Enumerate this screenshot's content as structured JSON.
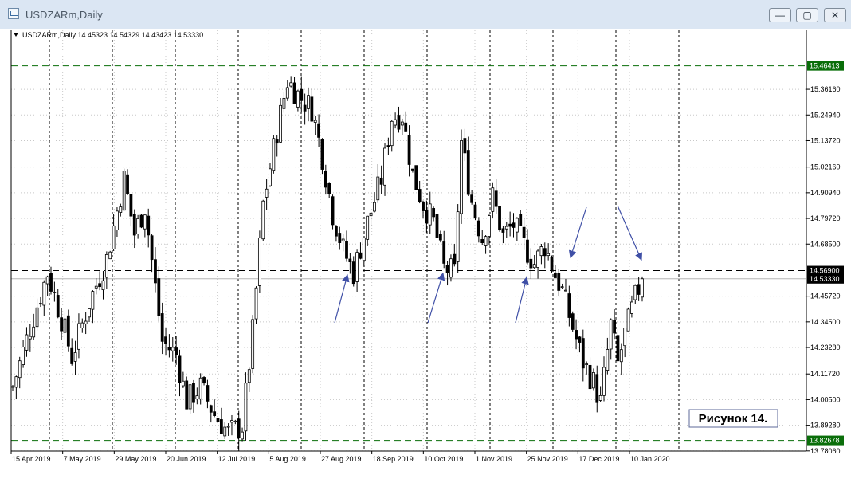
{
  "window": {
    "title": "USDZARm,Daily",
    "minimize_glyph": "—",
    "restore_glyph": "▢",
    "close_glyph": "✕"
  },
  "header": {
    "label": "USDZARm,Daily  14.45323 14.54329 14.43423 14.53330",
    "dropdown_icon": "triangle-down-icon"
  },
  "caption": "Рисунок 14.",
  "colors": {
    "background": "#ffffff",
    "candle": "#000000",
    "grid_dotted": "#c8c8c8",
    "session_separator": "#000000",
    "support_resistance": "#0a6e0a",
    "horizontal_level": "#000000",
    "arrow": "#3f4fa6",
    "price_label_bg": "#0a6e0a",
    "current_price_bg": "#000000"
  },
  "chart_data": {
    "type": "candlestick",
    "symbol": "USDZARm",
    "timeframe": "Daily",
    "ohlc": {
      "open": 14.45323,
      "high": 14.54329,
      "low": 14.43423,
      "close": 14.5333
    },
    "ylim": [
      13.78,
      15.55
    ],
    "y_ticks": [
      "15.36160",
      "15.24940",
      "15.13720",
      "15.02160",
      "14.90940",
      "14.79720",
      "14.68500",
      "14.45720",
      "14.34500",
      "14.23280",
      "14.11720",
      "14.00500",
      "13.89280",
      "13.78060"
    ],
    "x_ticks": [
      "15 Apr 2019",
      "7 May 2019",
      "29 May 2019",
      "20 Jun 2019",
      "12 Jul 2019",
      "5 Aug 2019",
      "27 Aug 2019",
      "18 Sep 2019",
      "10 Oct 2019",
      "1 Nov 2019",
      "25 Nov 2019",
      "17 Dec 2019",
      "10 Jan 2020"
    ],
    "levels": [
      {
        "value": 15.46413,
        "label": "15.46413",
        "style": "dashed-green"
      },
      {
        "value": 14.569,
        "label": "14.56900",
        "style": "dashed-black"
      },
      {
        "value": 14.5333,
        "label": "14.53330",
        "style": "current-price"
      },
      {
        "value": 13.82678,
        "label": "13.82678",
        "style": "dashed-green"
      }
    ],
    "anchors": [
      [
        0,
        14.06
      ],
      [
        5,
        14.32
      ],
      [
        10,
        14.56
      ],
      [
        14,
        14.36
      ],
      [
        17,
        14.19
      ],
      [
        22,
        14.43
      ],
      [
        27,
        14.62
      ],
      [
        32,
        14.97
      ],
      [
        35,
        14.73
      ],
      [
        38,
        14.85
      ],
      [
        43,
        14.26
      ],
      [
        47,
        14.2
      ],
      [
        50,
        14.0
      ],
      [
        54,
        14.06
      ],
      [
        58,
        13.94
      ],
      [
        62,
        13.86
      ],
      [
        66,
        13.89
      ],
      [
        69,
        14.3
      ],
      [
        72,
        14.86
      ],
      [
        76,
        15.18
      ],
      [
        79,
        15.4
      ],
      [
        83,
        15.32
      ],
      [
        86,
        15.28
      ],
      [
        89,
        15.07
      ],
      [
        92,
        14.82
      ],
      [
        95,
        14.66
      ],
      [
        98,
        14.56
      ],
      [
        102,
        14.78
      ],
      [
        106,
        14.97
      ],
      [
        109,
        15.24
      ],
      [
        112,
        15.25
      ],
      [
        115,
        14.99
      ],
      [
        118,
        14.86
      ],
      [
        121,
        14.78
      ],
      [
        124,
        14.58
      ],
      [
        127,
        14.56
      ],
      [
        129,
        15.13
      ],
      [
        132,
        14.87
      ],
      [
        135,
        14.71
      ],
      [
        138,
        14.89
      ],
      [
        141,
        14.72
      ],
      [
        144,
        14.77
      ],
      [
        147,
        14.68
      ],
      [
        150,
        14.6
      ],
      [
        153,
        14.68
      ],
      [
        156,
        14.55
      ],
      [
        158,
        14.48
      ],
      [
        161,
        14.32
      ],
      [
        164,
        14.17
      ],
      [
        167,
        14.08
      ],
      [
        169,
        13.99
      ],
      [
        172,
        14.33
      ],
      [
        174,
        14.16
      ],
      [
        176,
        14.29
      ],
      [
        179,
        14.45
      ],
      [
        181,
        14.53
      ]
    ],
    "arrows": [
      {
        "from": [
          420,
          405
        ],
        "to": [
          436,
          345
        ]
      },
      {
        "from": [
          537,
          405
        ],
        "to": [
          556,
          343
        ]
      },
      {
        "from": [
          647,
          405
        ],
        "to": [
          661,
          348
        ]
      },
      {
        "from": [
          736,
          260
        ],
        "to": [
          716,
          323
        ]
      },
      {
        "from": [
          775,
          258
        ],
        "to": [
          805,
          326
        ]
      }
    ]
  }
}
